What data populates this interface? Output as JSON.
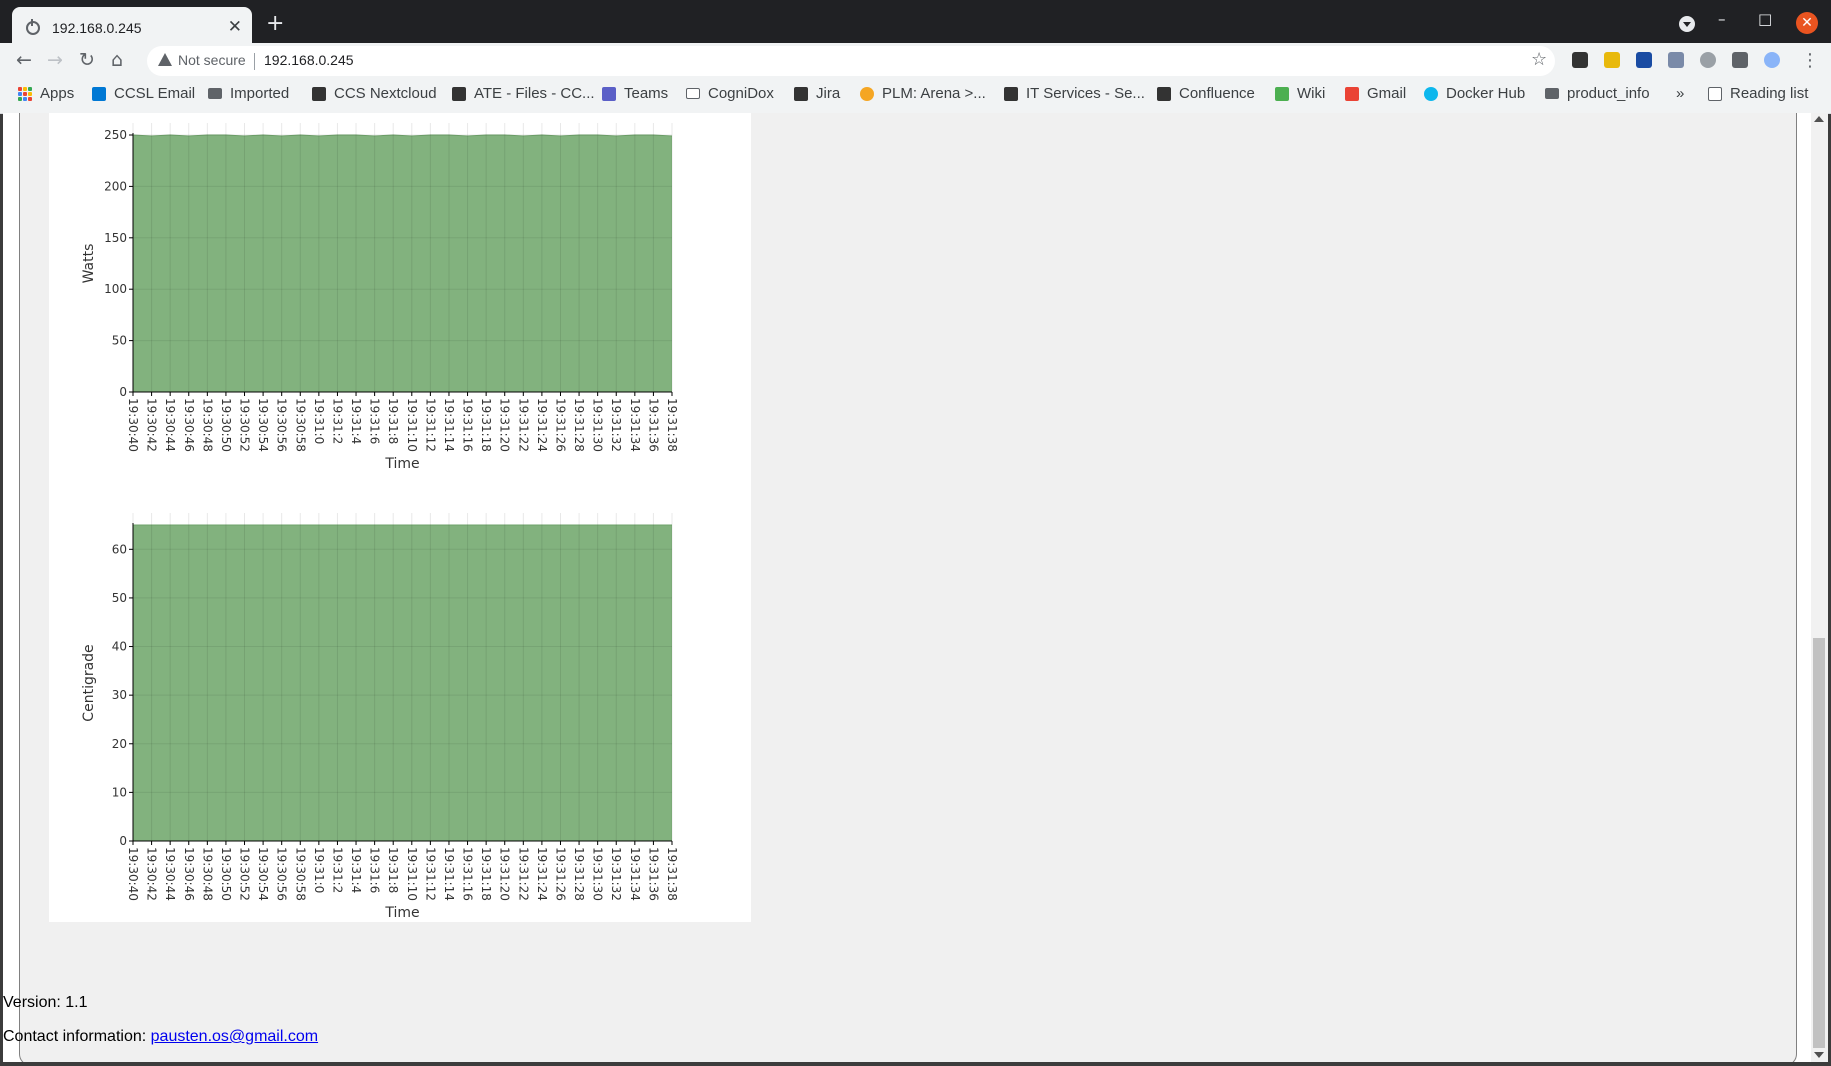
{
  "browser": {
    "tab_title": "192.168.0.245",
    "new_tab_label": "+",
    "security_label": "Not secure",
    "url": "192.168.0.245",
    "window_controls": {
      "minimize": "–",
      "maximize": "□",
      "close": "✕"
    },
    "nav": {
      "back": "←",
      "forward": "→",
      "reload": "↻",
      "home": "⌂"
    },
    "bookmarks": [
      {
        "label": "Apps",
        "icon": "apps-grid-icon"
      },
      {
        "label": "CCSL Email",
        "icon": "outlook-icon",
        "color": "#0078d4"
      },
      {
        "label": "Imported",
        "icon": "folder-icon"
      },
      {
        "label": "CCS Nextcloud",
        "icon": "pinwheel-icon",
        "color": "#333333"
      },
      {
        "label": "ATE - Files - CC...",
        "icon": "pinwheel-icon",
        "color": "#333333"
      },
      {
        "label": "Teams",
        "icon": "teams-icon",
        "color": "#5b5fc7"
      },
      {
        "label": "CogniDox",
        "icon": "folder-outline-icon"
      },
      {
        "label": "Jira",
        "icon": "jira-icon",
        "color": "#333333"
      },
      {
        "label": "PLM: Arena >...",
        "icon": "arena-icon",
        "color": "#f5a623"
      },
      {
        "label": "IT Services - Se...",
        "icon": "it-services-icon",
        "color": "#333333"
      },
      {
        "label": "Confluence",
        "icon": "pinwheel-icon",
        "color": "#333333"
      },
      {
        "label": "Wiki",
        "icon": "wiki-icon",
        "color": "#4caf50"
      },
      {
        "label": "Gmail",
        "icon": "gmail-icon",
        "color": "#ea4335"
      },
      {
        "label": "Docker Hub",
        "icon": "docker-icon",
        "color": "#0db7ed"
      },
      {
        "label": "product_info",
        "icon": "folder-icon"
      }
    ],
    "more_bookmarks": "»",
    "reading_list": "Reading list"
  },
  "page": {
    "version_text": "Version: 1.1",
    "contact_label": "Contact information:",
    "contact_email": "pausten.os@gmail.com"
  },
  "chart_data": [
    {
      "type": "area",
      "title": "",
      "xlabel": "Time",
      "ylabel": "Watts",
      "ylim": [
        0,
        250
      ],
      "yticks": [
        0,
        50,
        100,
        150,
        200,
        250
      ],
      "x": [
        "19:30:40",
        "19:30:42",
        "19:30:44",
        "19:30:46",
        "19:30:48",
        "19:30:50",
        "19:30:52",
        "19:30:54",
        "19:30:56",
        "19:30:58",
        "19:31:0",
        "19:31:2",
        "19:31:4",
        "19:31:6",
        "19:31:8",
        "19:31:10",
        "19:31:12",
        "19:31:14",
        "19:31:16",
        "19:31:18",
        "19:31:20",
        "19:31:22",
        "19:31:24",
        "19:31:26",
        "19:31:28",
        "19:31:30",
        "19:31:32",
        "19:31:34",
        "19:31:36",
        "19:31:38"
      ],
      "values": [
        250,
        249,
        250,
        249,
        250,
        250,
        249,
        250,
        249,
        250,
        249,
        250,
        250,
        249,
        250,
        249,
        250,
        250,
        249,
        250,
        250,
        249,
        250,
        249,
        250,
        250,
        249,
        250,
        250,
        249
      ],
      "fill_color": "#82b27e",
      "grid": true
    },
    {
      "type": "area",
      "title": "",
      "xlabel": "Time",
      "ylabel": "Centigrade",
      "ylim": [
        0,
        65
      ],
      "yticks": [
        0,
        10,
        20,
        30,
        40,
        50,
        60
      ],
      "x": [
        "19:30:40",
        "19:30:42",
        "19:30:44",
        "19:30:46",
        "19:30:48",
        "19:30:50",
        "19:30:52",
        "19:30:54",
        "19:30:56",
        "19:30:58",
        "19:31:0",
        "19:31:2",
        "19:31:4",
        "19:31:6",
        "19:31:8",
        "19:31:10",
        "19:31:12",
        "19:31:14",
        "19:31:16",
        "19:31:18",
        "19:31:20",
        "19:31:22",
        "19:31:24",
        "19:31:26",
        "19:31:28",
        "19:31:30",
        "19:31:32",
        "19:31:34",
        "19:31:36",
        "19:31:38"
      ],
      "values": [
        65,
        65,
        65,
        65,
        65,
        65,
        65,
        65,
        65,
        65,
        65,
        65,
        65,
        65,
        65,
        65,
        65,
        65,
        65,
        65,
        65,
        65,
        65,
        65,
        65,
        65,
        65,
        65,
        65,
        65
      ],
      "fill_color": "#82b27e",
      "grid": true
    }
  ]
}
